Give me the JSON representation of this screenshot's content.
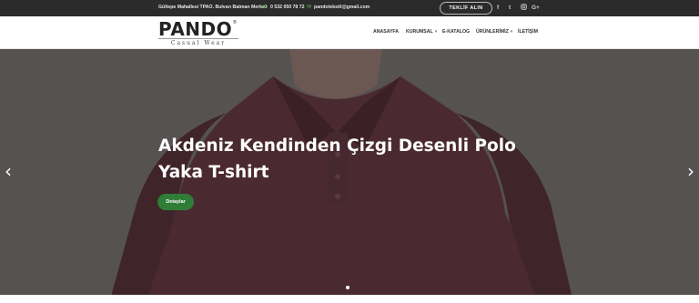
{
  "topbar": {
    "address": "Gültepe Mahallesi TPAO. Bulvarı Batman Merkez",
    "phone": "0 532 050 78 72",
    "email": "pandotekstil@gmail.com",
    "quote_button": "TEKLİF ALIN",
    "social": [
      "f",
      "t",
      "i",
      "G+"
    ]
  },
  "header": {
    "logo_word": "PANDO",
    "logo_reg": "®",
    "logo_tagline": "Casual Wear",
    "nav": [
      {
        "label": "ANASAYFA"
      },
      {
        "label": "KURUMSAL",
        "has_dropdown": true
      },
      {
        "label": "E-KATALOG"
      },
      {
        "label": "ÜRÜNLERİMİZ",
        "has_dropdown": true
      },
      {
        "label": "İLETİŞİM"
      }
    ],
    "caret": "▾"
  },
  "hero": {
    "title": "Akdeniz Kendinden Çizgi Desenli Polo Yaka T-shirt",
    "button": "Detaylar",
    "prev_arrow": "‹",
    "next_arrow": "›",
    "slide_count": 1,
    "active_slide": 1
  },
  "colors": {
    "topbar_bg": "#2b2b2b",
    "accent_green": "#2f7d36",
    "hero_bg": "#565251",
    "shirt": "#4a2a30"
  }
}
